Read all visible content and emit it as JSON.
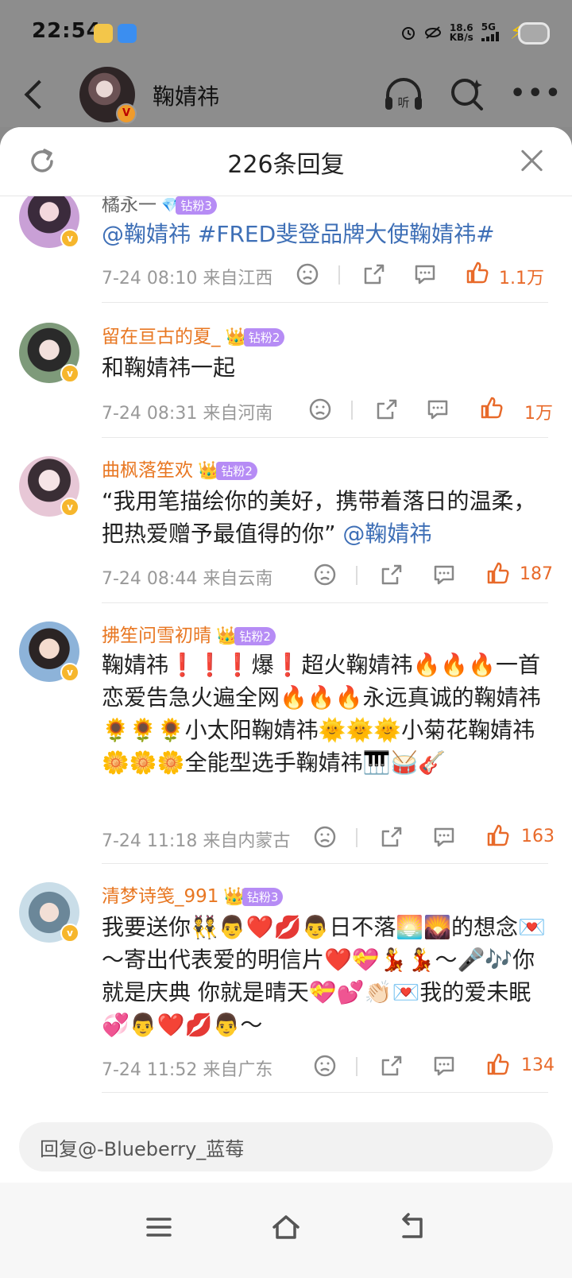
{
  "status_bar": {
    "time": "22:54",
    "speed_value": "18.6",
    "speed_unit": "KB/s",
    "network": "5G"
  },
  "header": {
    "title": "鞠婧祎",
    "avatar_badge": "V"
  },
  "panel": {
    "title": "226条回复"
  },
  "comments": [
    {
      "username": "橘永一",
      "fan_badge": "钻粉3",
      "text_mention": "@鞠婧祎 #FRED斐登品牌大使鞠婧祎#",
      "time": "7-24 08:10",
      "location": "来自江西",
      "likes": "1.1万"
    },
    {
      "username": "留在亘古的夏_",
      "fan_badge": "钻粉2",
      "text": "和鞠婧祎一起",
      "time": "7-24 08:31",
      "location": "来自河南",
      "likes": "1万"
    },
    {
      "username": "曲枫落笙欢",
      "fan_badge": "钻粉2",
      "text": "“我用笔描绘你的美好，携带着落日的温柔，把热爱赠予最值得的你” ",
      "mention": "@鞠婧祎",
      "time": "7-24 08:44",
      "location": "来自云南",
      "likes": "187"
    },
    {
      "username": "拂笙问雪初晴",
      "fan_badge": "钻粉2",
      "text": "鞠婧祎❗❗❗爆❗超火鞠婧祎🔥🔥🔥一首恋爱告急火遍全网🔥🔥🔥永远真诚的鞠婧祎🌻🌻🌻小太阳鞠婧祎🌞🌞🌞小菊花鞠婧祎🌼🌼🌼全能型选手鞠婧祎🎹🥁🎸",
      "time": "7-24 11:18",
      "location": "来自内蒙古",
      "likes": "163"
    },
    {
      "username": "清梦诗笺_991",
      "fan_badge": "钻粉3",
      "text": "我要送你👯👨❤️💋👨日不落🌅🌄的想念💌～寄出代表爱的明信片❤️💝💃💃～🎤🎶你就是庆典 你就是晴天💝💕👏🏻💌我的爱未眠💞👨❤️💋👨～",
      "time": "7-24 11:52",
      "location": "来自广东",
      "likes": "134"
    }
  ],
  "reply_box": {
    "placeholder": "回复@-Blueberry_蓝莓"
  },
  "icons": {
    "listen": "listen-headphones-icon",
    "search": "search-sparkle-icon",
    "more": "more-dots-icon",
    "refresh": "refresh-icon",
    "close": "close-icon",
    "dislike": "dislike-face-icon",
    "share": "share-icon",
    "comment": "comment-icon",
    "like": "thumb-up-icon"
  },
  "colors": {
    "username": "#e87722",
    "mention": "#3e6fb6",
    "likes": "#e86a2a",
    "fan_badge": "#b68cf5"
  }
}
